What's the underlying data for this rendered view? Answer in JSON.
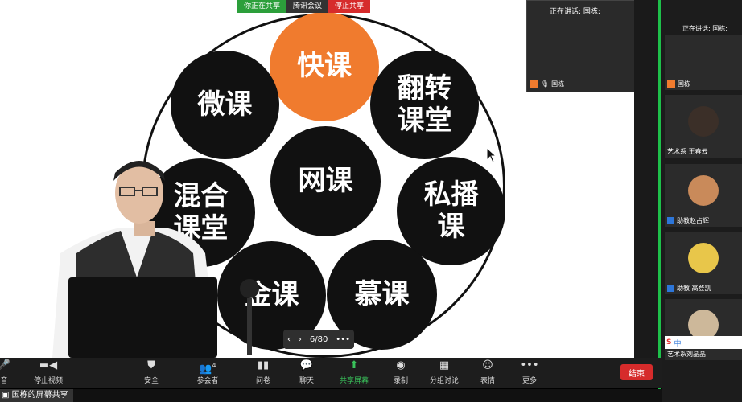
{
  "share_bar": {
    "sharing": "你正在共享",
    "meeting": "腾讯会议",
    "stop": "停止共享"
  },
  "slide": {
    "bubbles": {
      "kuaike": "快课",
      "weike": "微课",
      "fanzhuan": [
        "翻转",
        "课堂"
      ],
      "wangke": "网课",
      "hunhe": [
        "混合",
        "课堂"
      ],
      "sibo": [
        "私播",
        "课"
      ],
      "jinke": "金课",
      "muke": "慕课"
    },
    "page": "6/80"
  },
  "speaker_tile": {
    "heading": "正在讲话: 国栋;",
    "name": "国栋"
  },
  "sidebar": {
    "speaking": "正在讲话: 国栋;",
    "participants": [
      {
        "name": "国栋"
      },
      {
        "name": "艺术系 王春云"
      },
      {
        "name": "助教赵占辉"
      },
      {
        "name": "助教 高登凯"
      },
      {
        "name": "艺术系刘晶晶"
      }
    ],
    "ime": "中"
  },
  "toolbar": {
    "items": [
      {
        "label": "音",
        "icon": "microphone-icon"
      },
      {
        "label": "停止视频",
        "icon": "video-icon"
      },
      {
        "label": "安全",
        "icon": "shield-icon"
      },
      {
        "label": "参会者",
        "icon": "participants-icon",
        "count": "4"
      },
      {
        "label": "问卷",
        "icon": "survey-icon"
      },
      {
        "label": "聊天",
        "icon": "chat-icon"
      },
      {
        "label": "共享屏幕",
        "icon": "share-screen-icon"
      },
      {
        "label": "录制",
        "icon": "record-icon"
      },
      {
        "label": "分组讨论",
        "icon": "breakout-icon"
      },
      {
        "label": "表情",
        "icon": "emoji-icon"
      },
      {
        "label": "更多",
        "icon": "more-icon"
      }
    ],
    "end": "结束"
  },
  "status": {
    "label": "国栋的屏幕共享"
  },
  "colors": {
    "accent_green": "#2c9f3b",
    "end_red": "#d62b2b",
    "bubble_orange": "#f07b2e"
  }
}
